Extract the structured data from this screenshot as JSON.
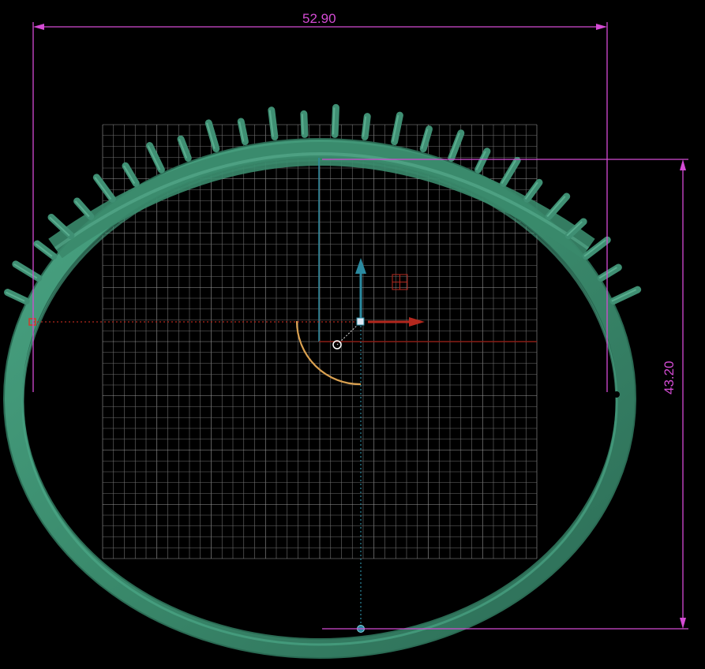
{
  "viewport": {
    "background": "#000000",
    "grid_color": "#7a7a7a",
    "ring_color": "#3f8f73",
    "ring_dark": "#2c6b55",
    "ring_light": "#5fb597"
  },
  "dimensions": {
    "color": "#d44bd4",
    "width_label": "52.90",
    "height_label": "43.20"
  },
  "gizmo": {
    "x_axis_color": "#b4281e",
    "y_axis_color": "#2b8aa0",
    "arc_color": "#d9a050",
    "x_axis_icon": "arrow-right-icon",
    "y_axis_icon": "arrow-up-icon",
    "plane_icon": "plane-handle-icon"
  }
}
